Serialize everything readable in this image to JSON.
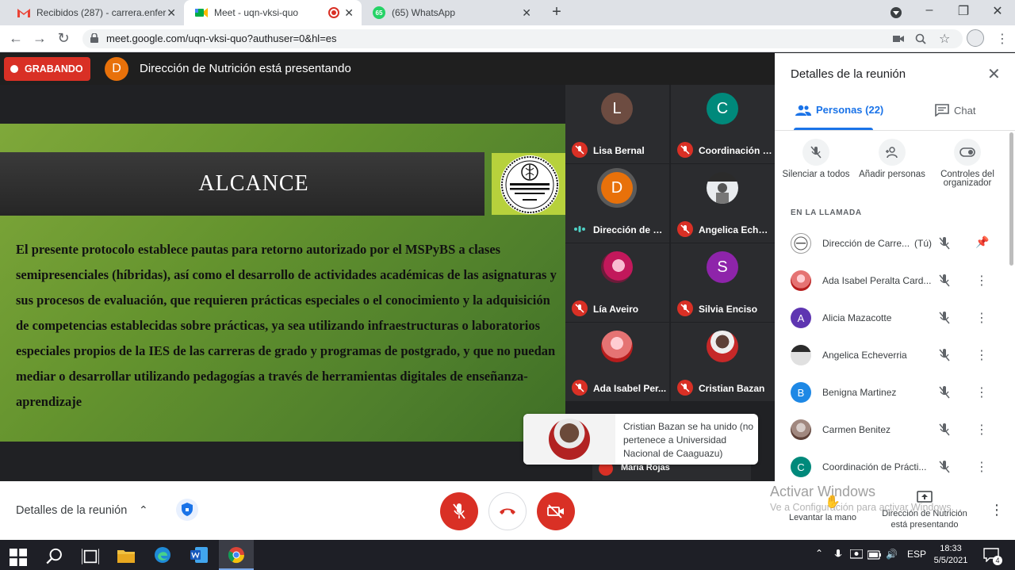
{
  "browser": {
    "tabs": [
      {
        "title": "Recibidos (287) - carrera.enferme",
        "icon": "gmail-icon",
        "active": false
      },
      {
        "title": "Meet - uqn-vksi-quo",
        "icon": "meet-icon",
        "active": true
      },
      {
        "title": "(65) WhatsApp",
        "icon": "whatsapp-icon",
        "active": false
      }
    ],
    "url": "meet.google.com/uqn-vksi-quo?authuser=0&hl=es",
    "whatsapp_badge": "65"
  },
  "meet": {
    "recording_label": "GRABANDO",
    "presenter_initial": "D",
    "presenting_text": "Dirección de Nutrición está presentando",
    "slide": {
      "title": "ALCANCE",
      "body": "El presente protocolo establece pautas para retorno autorizado por el MSPyBS a clases semipresenciales (híbridas), así como el desarrollo de actividades académicas de las asignaturas y sus procesos de evaluación, que requieren prácticas especiales o el conocimiento y la adquisición de competencias establecidas sobre prácticas, ya sea utilizando infraestructuras o laboratorios especiales propios de la IES de las carreras de grado y programas de postgrado, y que no puedan mediar o desarrollar utilizando pedagogías a través de herramientas digitales de enseñanza-aprendizaje",
      "logo_text": "Facultad de Ciencias de la Salud"
    },
    "tiles": [
      {
        "name": "Lisa Bernal",
        "initial": "L",
        "color": "#6d4c41"
      },
      {
        "name": "Coordinación d...",
        "initial": "C",
        "color": "#00897b"
      },
      {
        "name": "Dirección de N...",
        "initial": "D",
        "color": "#e8710a"
      },
      {
        "name": "Angelica Echev...",
        "initial": "",
        "color": "#e0e0e0"
      },
      {
        "name": "Lía Aveiro",
        "initial": "",
        "color": "#c2185b"
      },
      {
        "name": "Silvia Enciso",
        "initial": "S",
        "color": "#8e24aa"
      },
      {
        "name": "Ada Isabel Per...",
        "initial": "",
        "color": "#e57373"
      },
      {
        "name": "Cristian Bazan",
        "initial": "",
        "color": "#c62828"
      }
    ],
    "toast": "Cristian Bazan se ha unido (no pertenece a Universidad Nacional de Caaguazu)",
    "partial_tile_name": "Maria Rojas"
  },
  "panel": {
    "title": "Detalles de la reunión",
    "tab_people": "Personas (22)",
    "tab_chat": "Chat",
    "actions": [
      {
        "label": "Silenciar a todos",
        "icon": "mic-off-icon"
      },
      {
        "label": "Añadir personas",
        "icon": "add-person-icon"
      },
      {
        "label": "Controles del organizador",
        "icon": "toggle-icon"
      }
    ],
    "section_label": "EN LA LLAMADA",
    "participants": [
      {
        "name": "Dirección de Carre...",
        "suffix": "(Tú)",
        "initial": "",
        "color": "#ffffff"
      },
      {
        "name": "Ada Isabel Peralta Card...",
        "suffix": "",
        "initial": "",
        "color": "#e57373"
      },
      {
        "name": "Alicia Mazacotte",
        "suffix": "",
        "initial": "A",
        "color": "#5e35b1"
      },
      {
        "name": "Angelica Echeverria",
        "suffix": "",
        "initial": "",
        "color": "#9e9e9e"
      },
      {
        "name": "Benigna Martinez",
        "suffix": "",
        "initial": "B",
        "color": "#1e88e5"
      },
      {
        "name": "Carmen Benitez",
        "suffix": "",
        "initial": "",
        "color": "#a1887f"
      },
      {
        "name": "Coordinación de Prácti...",
        "suffix": "",
        "initial": "C",
        "color": "#00897b"
      }
    ]
  },
  "bottom": {
    "meeting_details": "Detalles de la reunión",
    "activate_title": "Activar Windows",
    "activate_sub": "Ve a Configuración para activar Windows.",
    "raise_hand": "Levantar la mano",
    "presenting_label": "Dirección de Nutrición está presentando"
  },
  "taskbar": {
    "language": "ESP",
    "time": "18:33",
    "date": "5/5/2021",
    "notifications": "4"
  }
}
